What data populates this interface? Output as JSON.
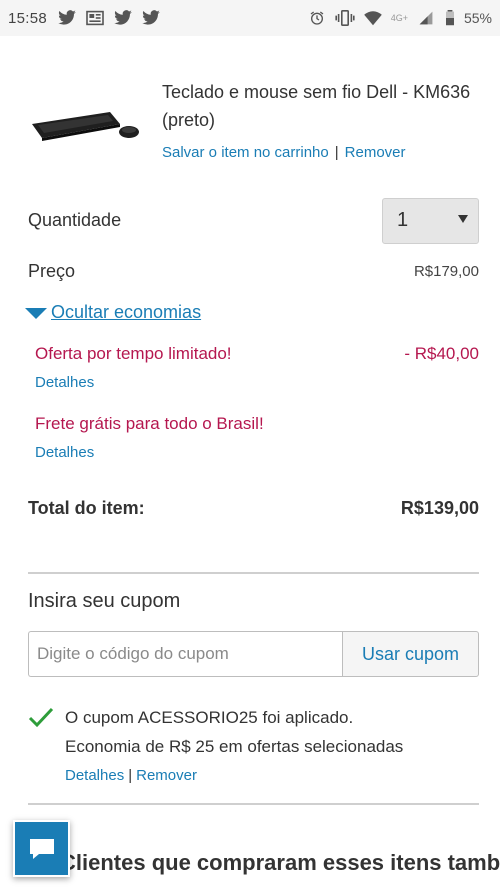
{
  "status_bar": {
    "time": "15:58",
    "network": "4G+",
    "battery": "55%",
    "left_icons": [
      "twitter-icon",
      "news-icon",
      "twitter-icon",
      "twitter-icon"
    ],
    "right_icons": [
      "alarm-icon",
      "vibrate-icon",
      "wifi-icon",
      "signal-icon",
      "battery-icon"
    ]
  },
  "product": {
    "title": "Teclado e mouse sem fio Dell - KM636 (preto)",
    "save_label": "Salvar o item no carrinho",
    "separator": "|",
    "remove_label": "Remover"
  },
  "quantity": {
    "label": "Quantidade",
    "value": "1"
  },
  "price": {
    "label": "Preço",
    "value": "R$179,00"
  },
  "savings_toggle": "Ocultar economias",
  "offers": [
    {
      "title": "Oferta por tempo limitado!",
      "amount": "- R$40,00",
      "details": "Detalhes"
    },
    {
      "title": "Frete grátis para todo o Brasil!",
      "details": "Detalhes"
    }
  ],
  "total": {
    "label": "Total do item:",
    "value": "R$139,00"
  },
  "coupon": {
    "heading": "Insira seu cupom",
    "placeholder": "Digite o código do cupom",
    "button": "Usar cupom",
    "applied_line1": "O cupom ACESSORIO25 foi aplicado.",
    "applied_line2": "Economia de R$ 25 em ofertas selecionadas",
    "details": "Detalhes",
    "separator": "|",
    "remove": "Remover"
  },
  "recommendations": {
    "title": "Clientes que compraram esses itens também"
  },
  "colors": {
    "link": "#1a7db5",
    "offer": "#b5174f",
    "check": "#2e9d3a"
  }
}
